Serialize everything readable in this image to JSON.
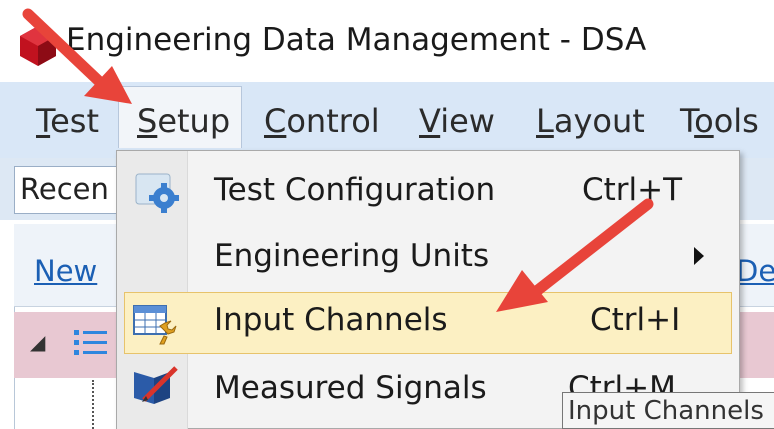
{
  "window": {
    "title": "Engineering Data Management - DSA"
  },
  "menubar": {
    "items": [
      {
        "label": "Test",
        "accel": "T",
        "rest": "est"
      },
      {
        "label": "Setup",
        "accel": "S",
        "rest": "etup"
      },
      {
        "label": "Control",
        "accel": "C",
        "rest": "ontrol"
      },
      {
        "label": "View",
        "accel": "V",
        "rest": "iew"
      },
      {
        "label": "Layout",
        "accel": "L",
        "rest": "ayout"
      },
      {
        "label": "Tools",
        "pre": "T",
        "accel": "o",
        "rest": "ols"
      }
    ]
  },
  "toolbar": {
    "recent_label": "Recen"
  },
  "panel": {
    "new_link": "New",
    "del_link": "Del"
  },
  "setup_menu": {
    "items": [
      {
        "label": "Test Configuration",
        "shortcut": "Ctrl+T",
        "icon": "gear-icon"
      },
      {
        "label": "Engineering Units",
        "shortcut": "",
        "icon": ""
      },
      {
        "label": "Input Channels",
        "shortcut": "Ctrl+I",
        "icon": "table-wrench-icon",
        "highlighted": true
      },
      {
        "label": "Measured Signals",
        "shortcut": "Ctrl+M",
        "icon": "signal-pen-icon"
      }
    ]
  },
  "tooltip": {
    "text": "Input Channels"
  },
  "colors": {
    "accent_arrow": "#e8443a",
    "highlight": "#fcf0c3",
    "menubar_bg": "#d9e7f7"
  }
}
